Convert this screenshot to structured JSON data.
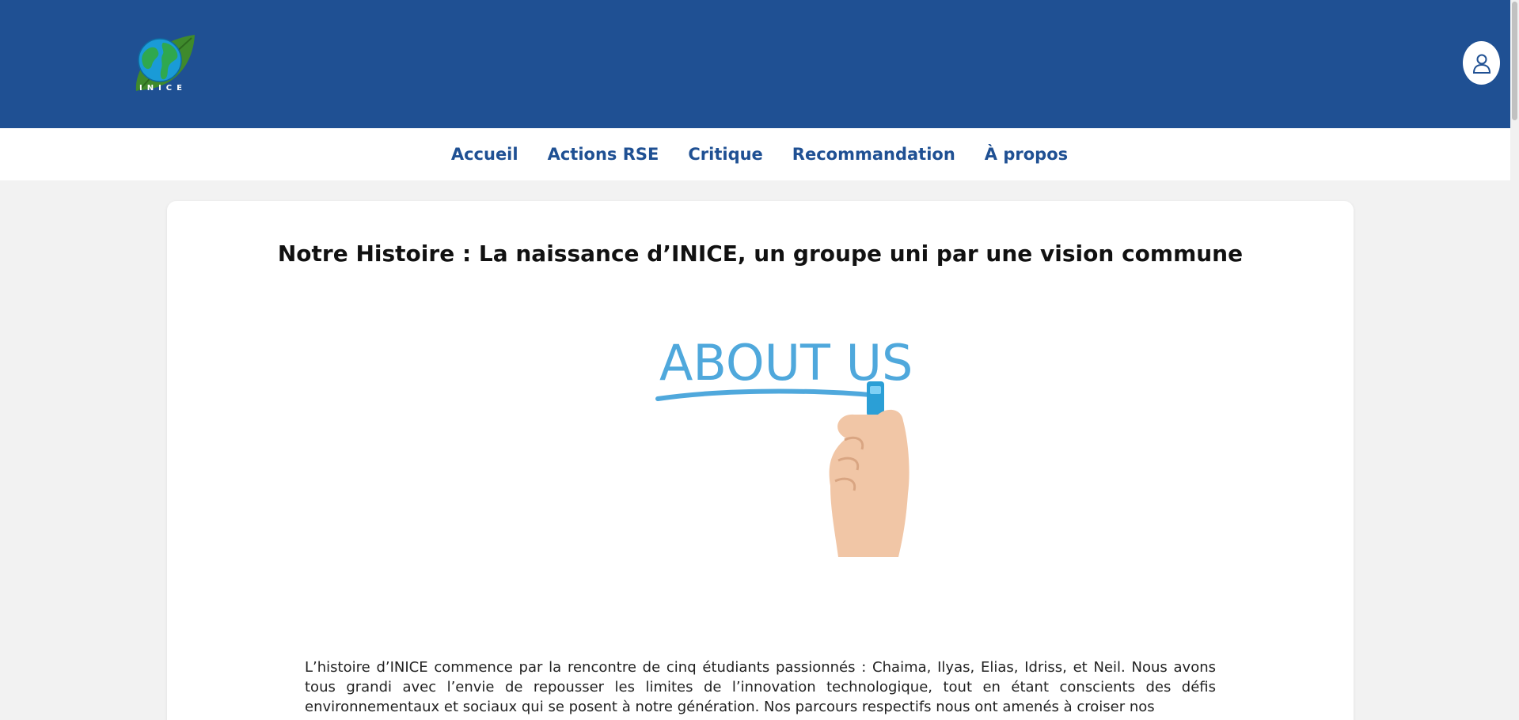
{
  "header": {
    "logo_text": "INICE",
    "brand_color": "#1f5093",
    "user_icon": "user-icon"
  },
  "nav": {
    "items": [
      {
        "label": "Accueil"
      },
      {
        "label": "Actions RSE"
      },
      {
        "label": "Critique"
      },
      {
        "label": "Recommandation"
      },
      {
        "label": "À propos"
      }
    ]
  },
  "main": {
    "title": "Notre Histoire : La naissance d’INICE, un groupe uni par une vision commune",
    "hero_text": "ABOUT US",
    "paragraph": "L’histoire d’INICE commence par la rencontre de cinq étudiants passionnés : Chaima, Ilyas, Elias, Idriss, et Neil. Nous avons tous grandi avec l’envie de repousser les limites de l’innovation technologique, tout en étant conscients des défis environnementaux et sociaux qui se posent à notre génération. Nos parcours respectifs nous ont amenés à croiser nos"
  }
}
